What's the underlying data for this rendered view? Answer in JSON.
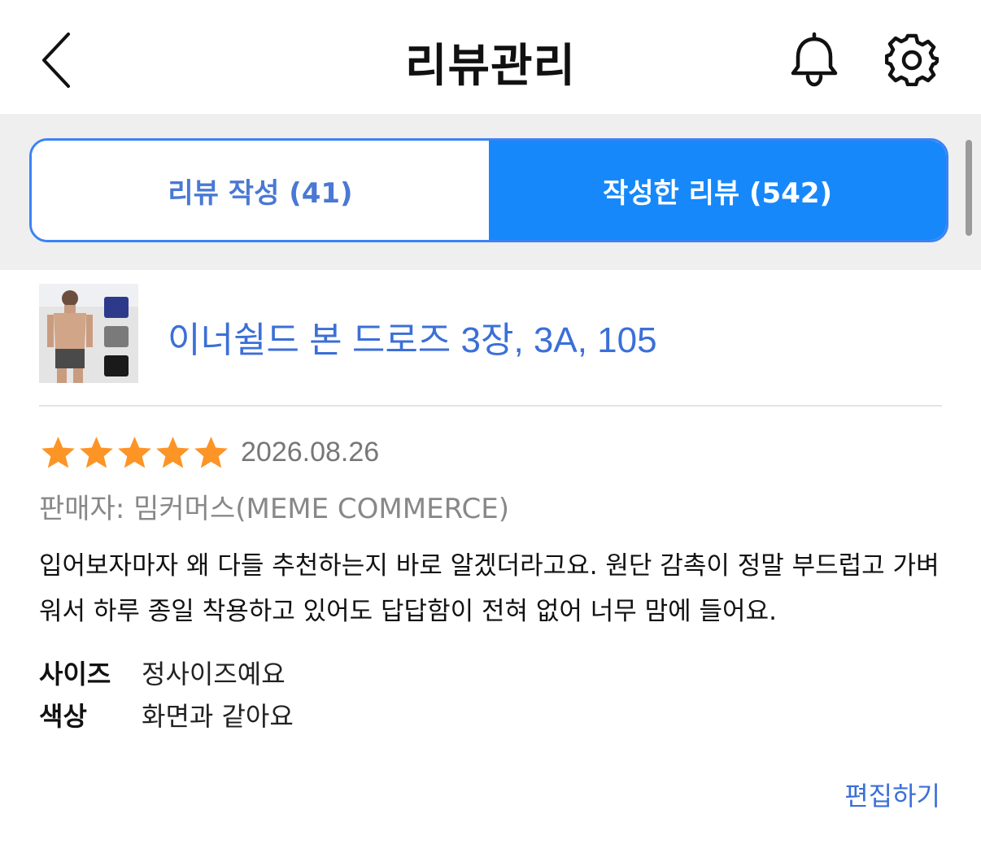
{
  "header": {
    "title": "리뷰관리",
    "back_icon": "chevron-left-icon",
    "bell_icon": "bell-icon",
    "settings_icon": "gear-icon"
  },
  "tabs": [
    {
      "label": "리뷰 작성 (41)",
      "active": false
    },
    {
      "label": "작성한 리뷰 (542)",
      "active": true
    }
  ],
  "colors": {
    "accent": "#1688fa",
    "link": "#3b6fd8",
    "star": "#fd9426"
  },
  "review": {
    "product_name": "이너쉴드 본 드로즈 3장, 3A, 105",
    "rating": 5,
    "rating_max": 5,
    "date": "2026.08.26",
    "seller": "판매자: 밈커머스(MEME COMMERCE)",
    "text": "입어보자마자 왜 다들 추천하는지 바로 알겠더라고요. 원단 감촉이 정말 부드럽고 가벼워서 하루 종일 착용하고 있어도 답답함이 전혀 없어 너무 맘에 들어요.",
    "attributes": [
      {
        "label": "사이즈",
        "value": "정사이즈예요"
      },
      {
        "label": "색상",
        "value": "화면과 같아요"
      }
    ],
    "edit_label": "편집하기"
  }
}
